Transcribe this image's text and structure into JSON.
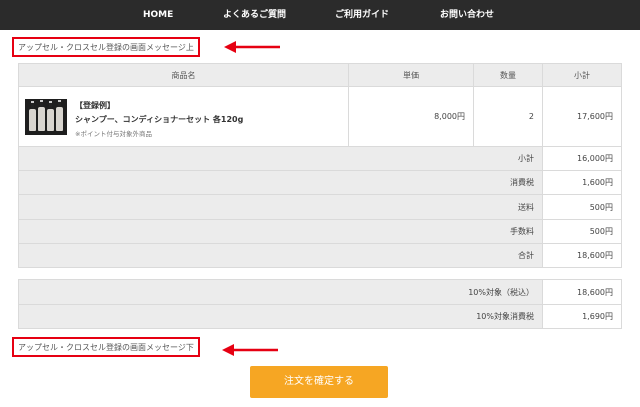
{
  "nav": {
    "items": [
      "HOME",
      "よくあるご質問",
      "ご利用ガイド",
      "お問い合わせ"
    ]
  },
  "upsell": {
    "top_message": "アップセル・クロスセル登録の画面メッセージ上",
    "bottom_message": "アップセル・クロスセル登録の画面メッセージ下"
  },
  "cart": {
    "headers": {
      "product": "商品名",
      "unit_price": "単価",
      "quantity": "数量",
      "subtotal": "小計"
    },
    "item": {
      "tag": "【登録例】",
      "name": "シャンプー、コンディショナーセット 各120g",
      "note": "※ポイント付与対象外商品",
      "unit_price": "8,000円",
      "quantity": "2",
      "subtotal": "17,600円"
    },
    "summary": [
      {
        "label": "小計",
        "value": "16,000円"
      },
      {
        "label": "消費税",
        "value": "1,600円"
      },
      {
        "label": "送料",
        "value": "500円"
      },
      {
        "label": "手数料",
        "value": "500円"
      },
      {
        "label": "合計",
        "value": "18,600円"
      }
    ],
    "tax": [
      {
        "label": "10%対象（税込）",
        "value": "18,600円"
      },
      {
        "label": "10%対象消費税",
        "value": "1,690円"
      }
    ]
  },
  "confirm_button": "注文を確定する",
  "colors": {
    "nav_bg": "#2b2b2b",
    "highlight_red": "#e60012",
    "button_orange": "#f6a623",
    "header_gray": "#ececec"
  }
}
